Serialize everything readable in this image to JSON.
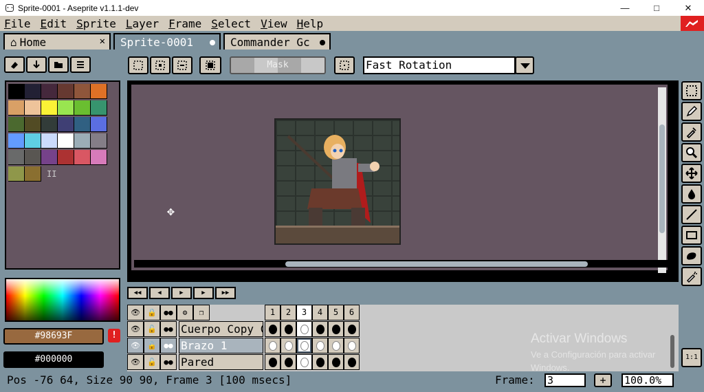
{
  "window": {
    "title": "Sprite-0001 - Aseprite v1.1.1-dev",
    "minimize_icon": "minimize-icon",
    "maximize_icon": "maximize-icon",
    "close_icon": "close-icon"
  },
  "menu": {
    "items": [
      "File",
      "Edit",
      "Sprite",
      "Layer",
      "Frame",
      "Select",
      "View",
      "Help"
    ]
  },
  "tabs": [
    {
      "label": "Home",
      "icon": "home-icon",
      "closable": true
    },
    {
      "label": "Sprite-0001",
      "active": true,
      "modified": true
    },
    {
      "label": "Commander Gc",
      "modified": true
    }
  ],
  "toolbar": {
    "mask_label": "Mask",
    "rotation_algorithm": "Fast Rotation"
  },
  "palette": {
    "colors": [
      "#000000",
      "#222034",
      "#45283c",
      "#663931",
      "#8f563b",
      "#df7126",
      "#d9a066",
      "#eec39a",
      "#fbf236",
      "#99e550",
      "#6abe30",
      "#37946e",
      "#4b692f",
      "#524b24",
      "#323c39",
      "#3f3f74",
      "#306082",
      "#5b6ee1",
      "#639bff",
      "#5fcde4",
      "#cbdbfc",
      "#ffffff",
      "#9badb7",
      "#847e87",
      "#696a6a",
      "#595652",
      "#76428a",
      "#ac3232",
      "#d95763",
      "#d77bba",
      "#8f974a",
      "#8a6f30"
    ],
    "more_indicator": "II"
  },
  "colors": {
    "foreground": "#98693F",
    "background": "#000000",
    "foreground_swatch": "#98693f",
    "background_swatch": "#000000"
  },
  "timeline": {
    "frames": [
      "1",
      "2",
      "3",
      "4",
      "5",
      "6"
    ],
    "current_frame": 3,
    "layers": [
      {
        "name": "Cuerpo Copy C",
        "cels": [
          1,
          1,
          0,
          1,
          1,
          1
        ]
      },
      {
        "name": "Brazo 1",
        "cels": [
          0,
          0,
          0,
          0,
          0,
          0
        ],
        "active": true
      },
      {
        "name": "Pared",
        "cels": [
          1,
          1,
          0,
          1,
          1,
          1
        ]
      }
    ]
  },
  "watermark": {
    "title": "Activar Windows",
    "subtitle": "Ve a Configuración para activar Windows."
  },
  "status": {
    "text": "Pos -76 64, Size 90 90, Frame 3 [100 msecs]",
    "frame_label": "Frame:",
    "frame_value": "3",
    "add_frame": "+",
    "zoom": "100.0%"
  },
  "onion_label": "1:1",
  "warning_label": "!"
}
